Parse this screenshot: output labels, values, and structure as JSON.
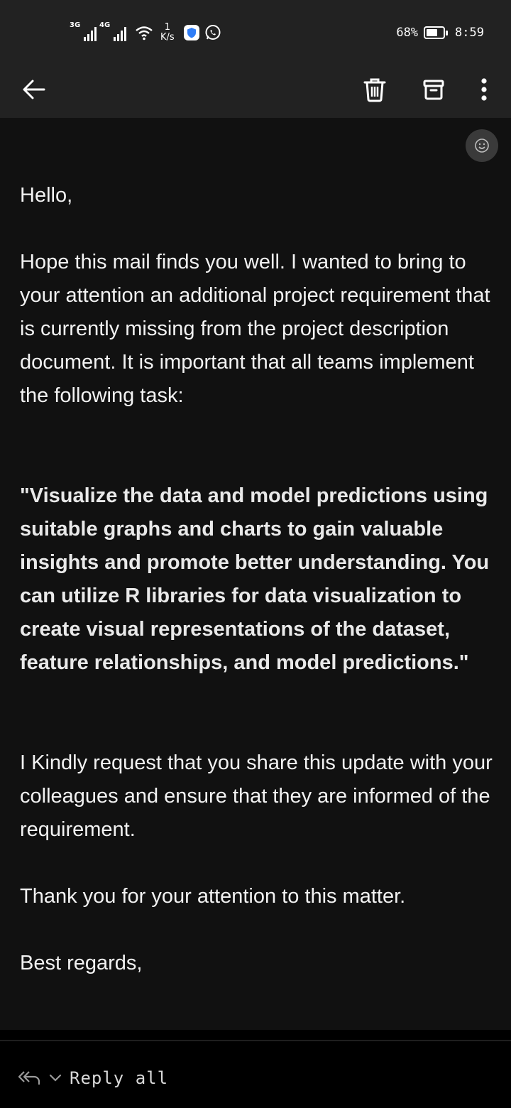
{
  "status_bar": {
    "network_1": "3G",
    "network_2": "4G",
    "speed_value": "1",
    "speed_unit": "K/s",
    "battery": "68%",
    "battery_level": 0.68,
    "time": "8:59"
  },
  "toolbar": {
    "icons": [
      "back-arrow-icon",
      "trash-icon",
      "archive-icon",
      "more-vert-icon"
    ]
  },
  "email": {
    "greeting": "Hello,",
    "para1": "Hope this mail finds you well. I wanted to bring to your attention an additional project requirement that is currently missing from the project description document. It is important that all teams implement the following task:",
    "quote": "\"Visualize the data and model predictions using suitable graphs and charts to gain valuable insights and promote better understanding. You can utilize R libraries for data visualization to create visual representations of the dataset, feature relationships, and model predictions.\"",
    "para2": "I Kindly request that you share this update with your colleagues and ensure that they are informed of the requirement.",
    "para3": "Thank you for your attention to this matter.",
    "closing": "Best regards,"
  },
  "bottom_bar": {
    "reply_label": "Reply all"
  },
  "colors": {
    "topband": "#222222",
    "background": "#111111",
    "bottombar": "#000000",
    "text": "#f2f2f2"
  }
}
